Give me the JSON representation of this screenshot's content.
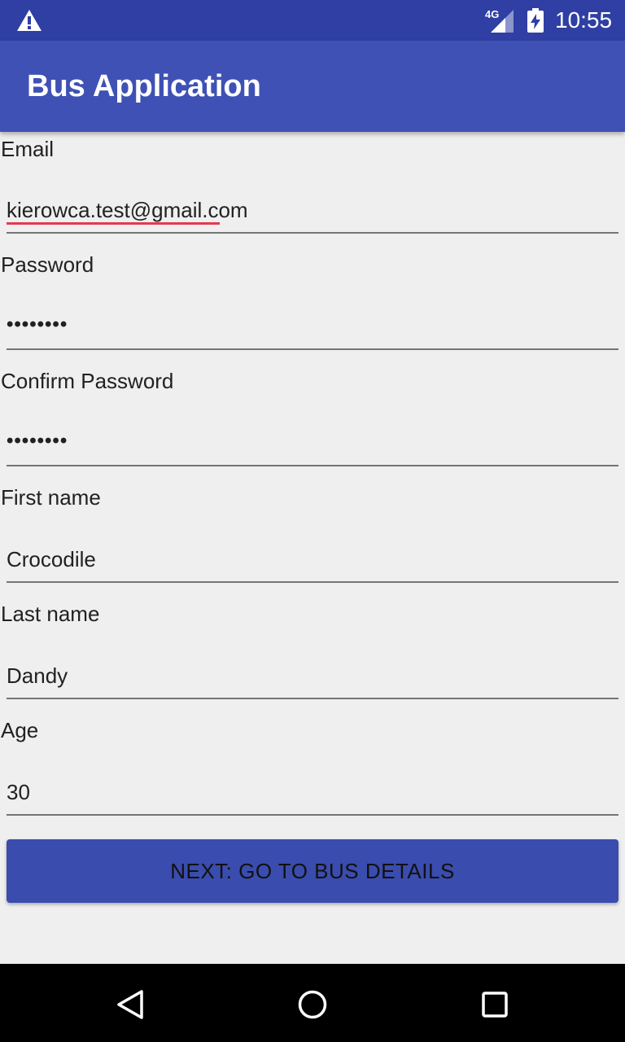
{
  "status_bar": {
    "network": "4G",
    "time": "10:55",
    "background": "#2f3fa4",
    "icons": [
      "warning-icon",
      "signal-icon",
      "battery-charging-icon"
    ]
  },
  "app_bar": {
    "title": "Bus Application",
    "background": "#3f51b5"
  },
  "form": {
    "email": {
      "label": "Email",
      "value": "kierowca.test@gmail.com"
    },
    "password": {
      "label": "Password",
      "masked": "••••••••"
    },
    "confirm_password": {
      "label": "Confirm Password",
      "masked": "••••••••"
    },
    "first_name": {
      "label": "First name",
      "value": "Crocodile"
    },
    "last_name": {
      "label": "Last name",
      "value": "Dandy"
    },
    "age": {
      "label": "Age",
      "value": "30"
    }
  },
  "next_button": {
    "label": "NEXT: GO TO BUS DETAILS",
    "background": "#3a4cad"
  },
  "nav_bar": {
    "icons": [
      "back-icon",
      "home-icon",
      "recents-icon"
    ]
  }
}
